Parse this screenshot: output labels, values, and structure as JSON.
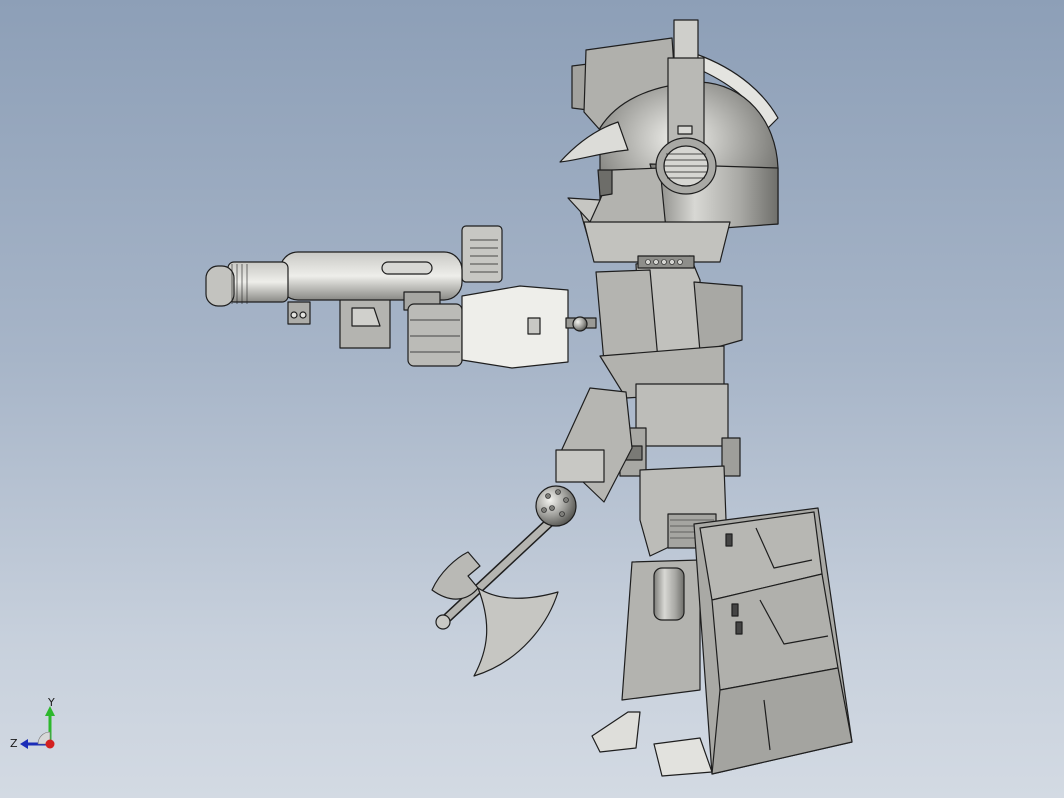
{
  "viewport": {
    "background_top": "#8d9fb7",
    "background_bottom": "#d3dae3",
    "model_color": "#9c9c98",
    "edge_color": "#1e1e1e"
  },
  "model": {
    "icons": [
      "robot-figure",
      "rocket-launcher",
      "battle-axe",
      "helmet",
      "shield-pack"
    ]
  },
  "triad": {
    "y_label": "Y",
    "z_label": "Z",
    "y_color": "#2db82d",
    "z_color": "#d32020",
    "x_color": "#1b2db8"
  }
}
